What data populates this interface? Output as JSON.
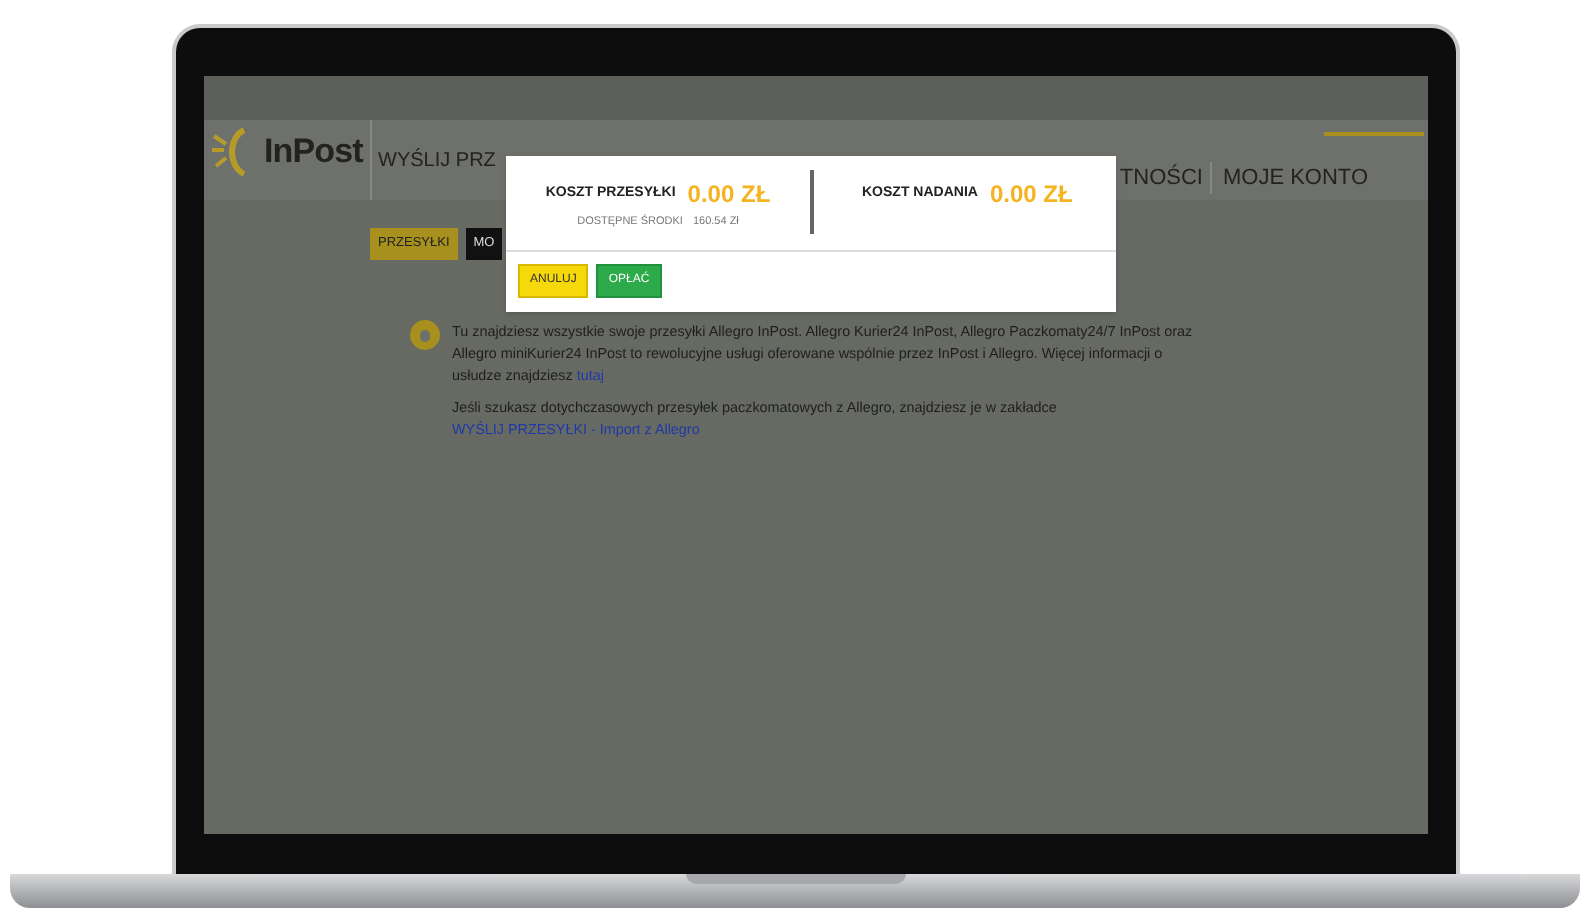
{
  "header": {
    "logo": "InPost",
    "nav": [
      {
        "label": "WYŚLIJ PRZ"
      },
      {
        "label": "TNOŚCI"
      },
      {
        "label": "MOJE KONTO"
      }
    ]
  },
  "tabs": [
    {
      "label": "PRZESYŁKI",
      "selected": true
    },
    {
      "label": "MO",
      "selected": false
    }
  ],
  "info": {
    "paragraphs": [
      {
        "text": "Tu znajdziesz wszystkie swoje przesyłki Allegro InPost. Allegro Kurier24 InPost, Allegro Paczkomaty24/7 InPost oraz Allegro miniKurier24 InPost to rewolucyjne usługi oferowane wspólnie przez InPost i Allegro. Więcej informacji o usłudze znajdziesz",
        "link": "tutaj"
      },
      {
        "text": "Jeśli szukasz dotychczasowych przesyłek paczkomatowych z Allegro, znajdziesz je w zakładce",
        "link": "WYŚLIJ PRZESYŁKI - Import z Allegro"
      }
    ]
  },
  "modal": {
    "shipping_cost": {
      "label": "KOSZT PRZESYŁKI",
      "value": "0.00 ZŁ"
    },
    "available_funds": {
      "label": "DOSTĘPNE ŚRODKI",
      "value": "160.54 Zł"
    },
    "posting_cost": {
      "label": "KOSZT NADANIA",
      "value": "0.00 ZŁ"
    },
    "buttons": [
      {
        "label": "ANULUJ",
        "kind": "cancel"
      },
      {
        "label": "OPŁAĆ",
        "kind": "pay"
      }
    ]
  }
}
